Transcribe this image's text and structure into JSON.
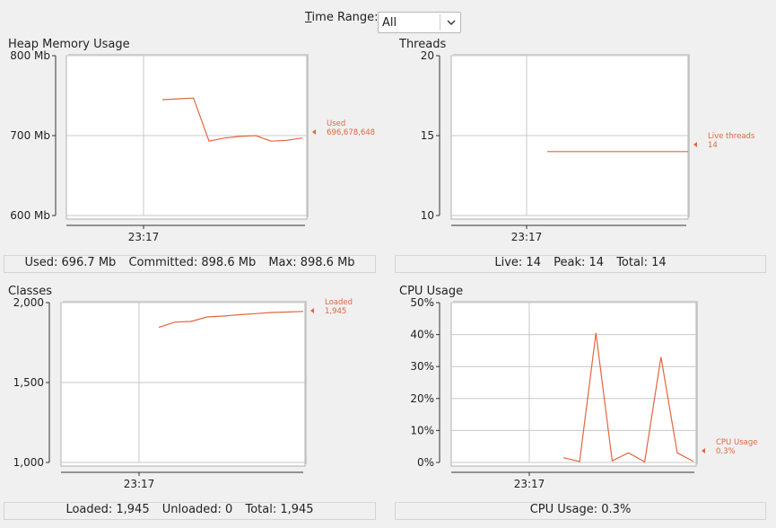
{
  "time_range": {
    "label": "Time Range:",
    "value": "All"
  },
  "panels": {
    "heap": {
      "title": "Heap Memory Usage",
      "stats": {
        "used": "Used: 696.7 Mb",
        "committed": "Committed: 898.6 Mb",
        "max": "Max: 898.6 Mb"
      },
      "legend": {
        "name": "Used",
        "value": "696,678,648"
      }
    },
    "threads": {
      "title": "Threads",
      "stats": {
        "live": "Live: 14",
        "peak": "Peak: 14",
        "total": "Total: 14"
      },
      "legend": {
        "name": "Live threads",
        "value": "14"
      }
    },
    "classes": {
      "title": "Classes",
      "stats": {
        "loaded": "Loaded: 1,945",
        "unloaded": "Unloaded: 0",
        "total": "Total: 1,945"
      },
      "legend": {
        "name": "Loaded",
        "value": "1,945"
      }
    },
    "cpu": {
      "title": "CPU Usage",
      "stats": {
        "usage": "CPU Usage: 0.3%"
      },
      "legend": {
        "name": "CPU Usage",
        "value": "0.3%"
      }
    }
  },
  "colors": {
    "series": "#e0673f",
    "grid": "#c8c8c8",
    "axis": "#333333"
  },
  "chart_data": [
    {
      "type": "line",
      "key": "heap",
      "ylim": [
        600,
        800
      ],
      "yticks": [
        600,
        700,
        800
      ],
      "ytick_labels": [
        "600 Mb",
        "700 Mb",
        "800 Mb"
      ],
      "xtick_labels": [
        "23:17"
      ],
      "x": [
        0,
        1,
        2,
        3,
        4,
        5,
        6,
        7,
        8
      ],
      "series": [
        {
          "name": "Used",
          "values": [
            745,
            746,
            747,
            693,
            697,
            699,
            700,
            693,
            694,
            697
          ]
        }
      ]
    },
    {
      "type": "line",
      "key": "threads",
      "ylim": [
        10,
        20
      ],
      "yticks": [
        10,
        15,
        20
      ],
      "ytick_labels": [
        "10",
        "15",
        "20"
      ],
      "xtick_labels": [
        "23:17"
      ],
      "series": [
        {
          "name": "Live threads",
          "values": [
            14,
            14
          ]
        }
      ]
    },
    {
      "type": "line",
      "key": "classes",
      "ylim": [
        1000,
        2000
      ],
      "yticks": [
        1000,
        1500,
        2000
      ],
      "ytick_labels": [
        "1,000",
        "1,500",
        "2,000"
      ],
      "xtick_labels": [
        "23:17"
      ],
      "series": [
        {
          "name": "Loaded",
          "values": [
            1845,
            1878,
            1882,
            1910,
            1916,
            1924,
            1931,
            1938,
            1941,
            1945
          ]
        }
      ]
    },
    {
      "type": "line",
      "key": "cpu",
      "ylim": [
        0,
        50
      ],
      "yticks": [
        0,
        10,
        20,
        30,
        40,
        50
      ],
      "ytick_labels": [
        "0%",
        "10%",
        "20%",
        "30%",
        "40%",
        "50%"
      ],
      "xtick_labels": [
        "23:17"
      ],
      "series": [
        {
          "name": "CPU Usage",
          "values": [
            1.5,
            0.3,
            40.5,
            0.5,
            3.0,
            0.2,
            33.0,
            3.0,
            0.3
          ]
        }
      ]
    }
  ]
}
